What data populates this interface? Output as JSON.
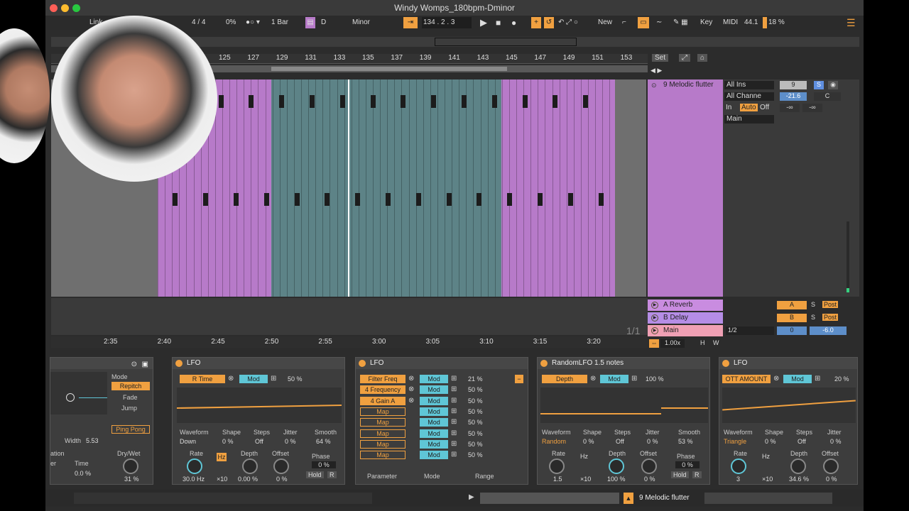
{
  "window": {
    "title": "Windy Womps_180bpm-Dminor"
  },
  "toolbar": {
    "link": "Link",
    "time_sig": "4 / 4",
    "percent": "0%",
    "bar": "1 Bar",
    "key": "D",
    "scale": "Minor",
    "position": "134 .  2 .  3",
    "new": "New",
    "key_btn": "Key",
    "midi": "MIDI",
    "sample_rate": "44.1",
    "cpu": "18 %"
  },
  "ruler": {
    "marks": [
      "125",
      "127",
      "129",
      "131",
      "133",
      "135",
      "137",
      "139",
      "141",
      "143",
      "145",
      "147",
      "149",
      "151",
      "153"
    ],
    "set": "Set"
  },
  "timeline": {
    "marks": [
      "2:35",
      "2:40",
      "2:45",
      "2:50",
      "2:55",
      "3:00",
      "3:05",
      "3:10",
      "3:15",
      "3:20"
    ],
    "fraction": "1/1",
    "zoom": "1.00x",
    "h": "H",
    "w": "W"
  },
  "track": {
    "name": "9 Melodic flutter",
    "input": "All Ins",
    "channel": "All Channe",
    "in": "In",
    "auto": "Auto",
    "off": "Off",
    "main": "Main",
    "num": "9",
    "s": "S",
    "vol": "-21.6",
    "pan": "C",
    "inf1": "-∞",
    "inf2": "-∞"
  },
  "returns": [
    {
      "name": "A Reverb",
      "letter": "A",
      "s": "S",
      "post": "Post",
      "color": "#c98ce0"
    },
    {
      "name": "B Delay",
      "letter": "B",
      "s": "S",
      "post": "Post",
      "color": "#b58de6"
    },
    {
      "name": "Main",
      "letter": "0",
      "s": "",
      "post": "",
      "color": "#f0a0b4"
    }
  ],
  "main_extra": {
    "ratio": "1/2",
    "vol": "-6.0"
  },
  "dev1": {
    "mode": "Mode",
    "repitch": "Repitch",
    "fade": "Fade",
    "jump": "Jump",
    "width_label": "Width",
    "width_val": "5.53",
    "ping": "Ping Pong",
    "ation": "ation",
    "er": "er",
    "time": "Time",
    "time_val": "0.0 %",
    "drywet": "Dry/Wet",
    "drywet_val": "31 %"
  },
  "dev2": {
    "title": "LFO",
    "target": "R Time",
    "mod": "Mod",
    "pct": "50 %",
    "waveform": "Waveform",
    "shape": "Shape",
    "steps": "Steps",
    "jitter": "Jitter",
    "smooth": "Smooth",
    "wf_val": "Down",
    "shape_val": "0 %",
    "steps_val": "Off",
    "jitter_val": "0 %",
    "smooth_val": "64 %",
    "rate": "Rate",
    "hz": "Hz",
    "rate_val": "30.0 Hz",
    "x10": "×10",
    "depth": "Depth",
    "depth_val": "0.00 %",
    "offset": "Offset",
    "offset_val": "0 %",
    "phase": "Phase",
    "phase_val": "0 %",
    "hold": "Hold",
    "r": "R"
  },
  "dev3": {
    "title": "LFO",
    "rows": [
      {
        "param": "Filter Freq",
        "mode": "Mod",
        "val": "21 %"
      },
      {
        "param": "4 Frequency",
        "mode": "Mod",
        "val": "50 %"
      },
      {
        "param": "4 Gain A",
        "mode": "Mod",
        "val": "50 %"
      },
      {
        "param": "Map",
        "mode": "Mod",
        "val": "50 %"
      },
      {
        "param": "Map",
        "mode": "Mod",
        "val": "50 %"
      },
      {
        "param": "Map",
        "mode": "Mod",
        "val": "50 %"
      },
      {
        "param": "Map",
        "mode": "Mod",
        "val": "50 %"
      },
      {
        "param": "Map",
        "mode": "Mod",
        "val": "50 %"
      }
    ],
    "col_param": "Parameter",
    "col_mode": "Mode",
    "col_range": "Range"
  },
  "dev4": {
    "title": "RandomLFO 1.5 notes",
    "target": "Depth",
    "mod": "Mod",
    "pct": "100 %",
    "waveform": "Waveform",
    "shape": "Shape",
    "steps": "Steps",
    "jitter": "Jitter",
    "smooth": "Smooth",
    "wf_val": "Random",
    "shape_val": "0 %",
    "steps_val": "Off",
    "jitter_val": "0 %",
    "smooth_val": "53 %",
    "rate": "Rate",
    "hz": "Hz",
    "rate_val": "1.5",
    "x10": "×10",
    "depth": "Depth",
    "depth_val": "100 %",
    "offset": "Offset",
    "offset_val": "0 %",
    "phase": "Phase",
    "phase_val": "0 %",
    "hold": "Hold",
    "r": "R"
  },
  "dev5": {
    "title": "LFO",
    "target": "OTT AMOUNT",
    "mod": "Mod",
    "pct": "20 %",
    "waveform": "Waveform",
    "shape": "Shape",
    "steps": "Steps",
    "jitter": "Jitter",
    "wf_val": "Triangle",
    "shape_val": "0 %",
    "steps_val": "Off",
    "jitter_val": "0 %",
    "rate": "Rate",
    "hz": "Hz",
    "rate_val": "3",
    "x10": "×10",
    "depth": "Depth",
    "depth_val": "34.6 %",
    "offset": "Offset",
    "offset_val": "0 %"
  },
  "bottom": {
    "track": "9 Melodic flutter"
  }
}
